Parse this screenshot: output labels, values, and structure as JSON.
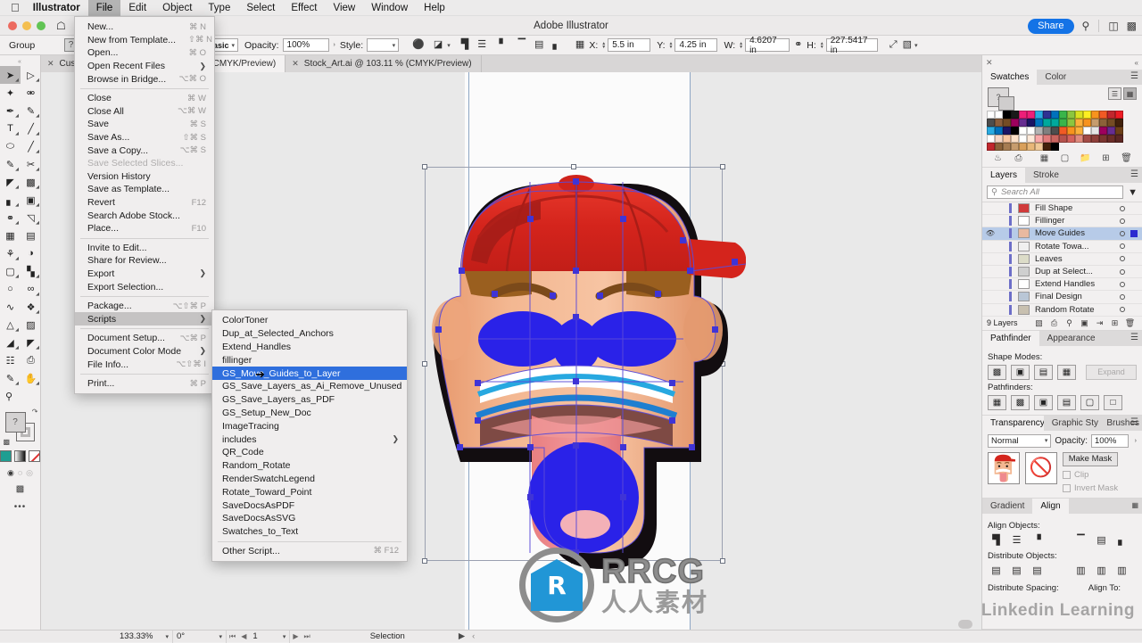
{
  "menubar": {
    "apple": "",
    "items": [
      {
        "label": "Illustrator",
        "bold": true
      },
      {
        "label": "File",
        "active": true
      },
      {
        "label": "Edit"
      },
      {
        "label": "Object"
      },
      {
        "label": "Type"
      },
      {
        "label": "Select"
      },
      {
        "label": "Effect"
      },
      {
        "label": "View"
      },
      {
        "label": "Window"
      },
      {
        "label": "Help"
      }
    ]
  },
  "titlebar": {
    "app_title": "Adobe Illustrator",
    "share_label": "Share",
    "home_icon": "home-icon",
    "search_icon": "search-icon",
    "arrange_icon": "arrange-documents-icon",
    "workspace_icon": "workspace-switcher-icon"
  },
  "controlbar": {
    "selection_label": "Group",
    "fill_label": "?",
    "stroke_preset": "Basic",
    "opacity_label": "Opacity:",
    "opacity_value": "100%",
    "style_label": "Style:",
    "x_label": "X:",
    "x_value": "5.5 in",
    "y_label": "Y:",
    "y_value": "4.25 in",
    "w_label": "W:",
    "w_value": "4.6207 in",
    "h_label": "H:",
    "h_value": "227.5417 in"
  },
  "tabs": [
    {
      "label": "Custo",
      "truncated": true,
      "active": false
    },
    {
      "label": "% (CMYK/Preview)",
      "active": false
    },
    {
      "label": "Stock_Art.ai @ 103.11 % (CMYK/Preview)",
      "active": false
    }
  ],
  "toolbar": {
    "tools": [
      {
        "name": "selection-tool",
        "glyph": "➤",
        "selected": true
      },
      {
        "name": "direct-selection-tool",
        "glyph": "➤"
      },
      {
        "name": "magic-wand-tool",
        "glyph": "✦"
      },
      {
        "name": "lasso-tool",
        "glyph": "◎"
      },
      {
        "name": "pen-tool",
        "glyph": "✒"
      },
      {
        "name": "curvature-tool",
        "glyph": "✐"
      },
      {
        "name": "type-tool",
        "glyph": "T"
      },
      {
        "name": "line-segment-tool",
        "glyph": "╱"
      },
      {
        "name": "ellipse-tool",
        "glyph": "⬭"
      },
      {
        "name": "paintbrush-tool",
        "glyph": "╱"
      },
      {
        "name": "pencil-tool",
        "glyph": "✎"
      },
      {
        "name": "scissors-tool",
        "glyph": "✂"
      },
      {
        "name": "rotate-tool",
        "glyph": "◔"
      },
      {
        "name": "scale-tool",
        "glyph": "⧉"
      },
      {
        "name": "width-tool",
        "glyph": "▐"
      },
      {
        "name": "free-transform-tool",
        "glyph": "⌧"
      },
      {
        "name": "shape-builder-tool",
        "glyph": "❂"
      },
      {
        "name": "perspective-grid-tool",
        "glyph": "◱"
      },
      {
        "name": "mesh-tool",
        "glyph": "▒"
      },
      {
        "name": "gradient-tool",
        "glyph": "▤"
      },
      {
        "name": "eyedropper-tool",
        "glyph": "⚗"
      },
      {
        "name": "blend-tool",
        "glyph": "◑"
      },
      {
        "name": "symbol-sprayer-tool",
        "glyph": "⚑"
      },
      {
        "name": "column-graph-tool",
        "glyph": "ᴵ"
      },
      {
        "name": "artboard-tool",
        "glyph": "○"
      },
      {
        "name": "slice-tool",
        "glyph": "∞"
      },
      {
        "name": "puppet-warp-tool",
        "glyph": "∿"
      },
      {
        "name": "eraser-tool",
        "glyph": "✶"
      },
      {
        "name": "gradient-mesh-tool",
        "glyph": "◭"
      },
      {
        "name": "crop-image-tool",
        "glyph": "⧉"
      },
      {
        "name": "print-tiling-tool",
        "glyph": "◢"
      },
      {
        "name": "reflect-tool",
        "glyph": "◤"
      },
      {
        "name": "measure-tool",
        "glyph": "⌗"
      },
      {
        "name": "paste-tool",
        "glyph": "⎙"
      },
      {
        "name": "edit-toolbar-tool",
        "glyph": "✏"
      },
      {
        "name": "hand-tool",
        "glyph": "✋"
      },
      {
        "name": "zoom-tool",
        "glyph": "⌕"
      }
    ],
    "fill_label": "?",
    "more_tools": "•••"
  },
  "swatches_panel": {
    "tabs": [
      {
        "label": "Swatches",
        "on": true
      },
      {
        "label": "Color",
        "on": false
      }
    ],
    "view_list_icon": "list-view-icon",
    "view_grid_icon": "grid-view-icon",
    "footer_icons": [
      "swatch-libraries-icon",
      "show-library-icon",
      "color-group-icon",
      "new-color-group-icon",
      "new-swatch-icon",
      "delete-swatch-icon"
    ],
    "colors": [
      "#ffffff",
      "#ffffff",
      "#000000",
      "#1a1a1a",
      "#ed1e79",
      "#ed1e79",
      "#29abe2",
      "#2e3192",
      "#0071bc",
      "#39b54a",
      "#8cc63f",
      "#d9e021",
      "#fcee21",
      "#f7931e",
      "#f15a24",
      "#c1272d",
      "#ed1c24",
      "#4d4d4d",
      "#8b5e3c",
      "#754c24",
      "#9e005d",
      "#662d91",
      "#1b1464",
      "#0071bc",
      "#00a99d",
      "#00a99d",
      "#39b54a",
      "#8cc63f",
      "#fbb03b",
      "#f7931e",
      "#c69c6d",
      "#8c6239",
      "#754c24",
      "#42210b",
      "#29abe2",
      "#0071bc",
      "#1b1464",
      "#000000",
      "#ffffff",
      "#ffffff",
      "#b3b3b3",
      "#808080",
      "#4d4d4d",
      "#f15a24",
      "#f7931e",
      "#fbb03b",
      "#ffffff",
      "#e6e6e6",
      "#9e005d",
      "#662d91",
      "#6d3f18",
      "#ffffff",
      "#f5d6c6",
      "#f7c5a0",
      "#fbe0c8",
      "#ffffff",
      "#fde8d8",
      "#f9a8a8",
      "#e07b7b",
      "#c9635e",
      "#b5524d",
      "#d4625c",
      "#e08a7d",
      "#a34b45",
      "#8e3f3a",
      "#7a3530",
      "#6b2d28",
      "#5c2723",
      "#c1272d",
      "#8c6239",
      "#a67c52",
      "#c69c6d",
      "#d9a05b",
      "#e8b778",
      "#f0c896",
      "#42210b",
      "#000000",
      "",
      "",
      "",
      "",
      "",
      "",
      "",
      ""
    ]
  },
  "layers_panel": {
    "tabs": [
      {
        "label": "Layers",
        "on": true
      },
      {
        "label": "Stroke",
        "on": false
      }
    ],
    "search_placeholder": "Search All",
    "filter_icon": "filter-icon",
    "rows": [
      {
        "name": "Fill Shape",
        "visible": false,
        "selected": false,
        "thumb": "#d03a3a"
      },
      {
        "name": "Fillinger",
        "visible": false,
        "selected": false,
        "thumb": "#ffffff"
      },
      {
        "name": "Move Guides",
        "visible": true,
        "selected": true,
        "thumb": "#e8b9a0"
      },
      {
        "name": "Rotate Towa...",
        "visible": false,
        "selected": false,
        "thumb": "#f0f0f0"
      },
      {
        "name": "Leaves",
        "visible": false,
        "selected": false,
        "thumb": "#dcdcc8"
      },
      {
        "name": "Dup at Select...",
        "visible": false,
        "selected": false,
        "thumb": "#cfcfcf"
      },
      {
        "name": "Extend Handles",
        "visible": false,
        "selected": false,
        "thumb": "#ffffff"
      },
      {
        "name": "Final Design",
        "visible": false,
        "selected": false,
        "thumb": "#b9c6d6"
      },
      {
        "name": "Random Rotate",
        "visible": false,
        "selected": false,
        "thumb": "#c8c0b0"
      }
    ],
    "count_label": "9 Layers",
    "footer_icons": [
      "locate-object-icon",
      "make-release-clipping-mask-icon",
      "search-layer-icon",
      "new-sublayer-icon",
      "collect-in-new-layer-icon",
      "new-layer-icon",
      "delete-layer-icon"
    ]
  },
  "pathfinder_panel": {
    "tabs": [
      {
        "label": "Pathfinder",
        "on": true
      },
      {
        "label": "Appearance",
        "on": false
      }
    ],
    "shape_modes_label": "Shape Modes:",
    "expand_label": "Expand",
    "pathfinders_label": "Pathfinders:",
    "shape_mode_icons": [
      "unite-icon",
      "minus-front-icon",
      "intersect-icon",
      "exclude-icon"
    ],
    "pathfinder_icons": [
      "divide-icon",
      "trim-icon",
      "merge-icon",
      "crop-icon",
      "outline-icon",
      "minus-back-icon"
    ]
  },
  "transparency_panel": {
    "tabs": [
      {
        "label": "Transparency",
        "on": true
      },
      {
        "label": "Graphic Sty",
        "on": false
      },
      {
        "label": "Brushes",
        "on": false
      }
    ],
    "blend_mode": "Normal",
    "opacity_label": "Opacity:",
    "opacity_value": "100%",
    "make_mask_label": "Make Mask",
    "clip_label": "Clip",
    "invert_mask_label": "Invert Mask",
    "mask_icon": "no-mask-icon"
  },
  "align_panel": {
    "tabs": [
      {
        "label": "Gradient",
        "on": false
      },
      {
        "label": "Align",
        "on": true
      }
    ],
    "align_objects_label": "Align Objects:",
    "distribute_objects_label": "Distribute Objects:",
    "distribute_spacing_label": "Distribute Spacing:",
    "align_to_label": "Align To:",
    "align_icons": [
      "align-left-icon",
      "align-horizontal-center-icon",
      "align-right-icon",
      "align-top-icon",
      "align-vertical-center-icon",
      "align-bottom-icon"
    ],
    "distribute_icons": [
      "distribute-top-icon",
      "distribute-vertical-center-icon",
      "distribute-bottom-icon",
      "distribute-left-icon",
      "distribute-horizontal-center-icon",
      "distribute-right-icon"
    ]
  },
  "statusbar": {
    "zoom": "133.33%",
    "rotation": "0°",
    "page": "1",
    "mode": "Selection"
  },
  "file_menu": {
    "items": [
      {
        "label": "New...",
        "key": "⌘ N"
      },
      {
        "label": "New from Template...",
        "key": "⇧⌘ N"
      },
      {
        "label": "Open...",
        "key": "⌘ O"
      },
      {
        "label": "Open Recent Files",
        "arrow": true
      },
      {
        "label": "Browse in Bridge...",
        "key": "⌥⌘ O"
      },
      {
        "sep": true
      },
      {
        "label": "Close",
        "key": "⌘ W"
      },
      {
        "label": "Close All",
        "key": "⌥⌘ W"
      },
      {
        "label": "Save",
        "key": "⌘ S"
      },
      {
        "label": "Save As...",
        "key": "⇧⌘ S"
      },
      {
        "label": "Save a Copy...",
        "key": "⌥⌘ S"
      },
      {
        "label": "Save Selected Slices...",
        "dim": true
      },
      {
        "label": "Version History"
      },
      {
        "label": "Save as Template..."
      },
      {
        "label": "Revert",
        "key": "F12"
      },
      {
        "label": "Search Adobe Stock..."
      },
      {
        "label": "Place...",
        "key": "F10"
      },
      {
        "sep": true
      },
      {
        "label": "Invite to Edit..."
      },
      {
        "label": "Share for Review..."
      },
      {
        "label": "Export",
        "arrow": true
      },
      {
        "label": "Export Selection..."
      },
      {
        "sep": true
      },
      {
        "label": "Package...",
        "key": "⌥⇧⌘ P"
      },
      {
        "label": "Scripts",
        "arrow": true,
        "highlight": true
      },
      {
        "sep": true
      },
      {
        "label": "Document Setup...",
        "key": "⌥⌘ P"
      },
      {
        "label": "Document Color Mode",
        "arrow": true
      },
      {
        "label": "File Info...",
        "key": "⌥⇧⌘ I"
      },
      {
        "sep": true
      },
      {
        "label": "Print...",
        "key": "⌘ P"
      }
    ]
  },
  "scripts_menu": {
    "items": [
      {
        "label": "ColorToner"
      },
      {
        "label": "Dup_at_Selected_Anchors"
      },
      {
        "label": "Extend_Handles"
      },
      {
        "label": "fillinger"
      },
      {
        "label": "GS_Move_Guides_to_Layer",
        "selected": true
      },
      {
        "label": "GS_Save_Layers_as_Ai_Remove_Unused"
      },
      {
        "label": "GS_Save_Layers_as_PDF"
      },
      {
        "label": "GS_Setup_New_Doc"
      },
      {
        "label": "ImageTracing"
      },
      {
        "label": "includes",
        "arrow": true
      },
      {
        "label": "QR_Code"
      },
      {
        "label": "Random_Rotate"
      },
      {
        "label": "RenderSwatchLegend"
      },
      {
        "label": "Rotate_Toward_Point"
      },
      {
        "label": "SaveDocsAsPDF"
      },
      {
        "label": "SaveDocsAsSVG"
      },
      {
        "label": "Swatches_to_Text"
      },
      {
        "sep": true
      },
      {
        "label": "Other Script...",
        "key": "⌘ F12"
      }
    ]
  },
  "watermarks": {
    "linkedin": "Linkedin Learning",
    "rrcg_letters": "RRCG",
    "rrcg_cn": "人人素材",
    "rrcg_mark": "R"
  }
}
